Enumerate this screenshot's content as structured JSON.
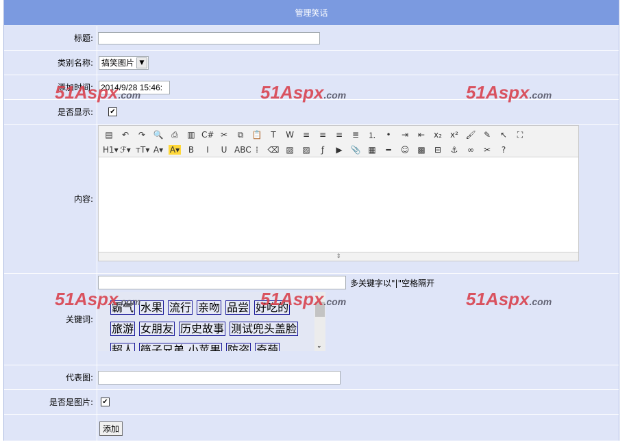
{
  "header": {
    "title": "管理笑话"
  },
  "fields": {
    "title_label": "标题:",
    "category_label": "类别名称:",
    "category_value": "搞笑图片",
    "time_label": "添加时间:",
    "time_value": "2014/9/28 15:46:",
    "show_label": "是否显示:",
    "show_checked": true,
    "content_label": "内容:",
    "keywords_label": "关键词:",
    "keywords_hint": "多关键字以\"|\"空格隔开",
    "image_label": "代表图:",
    "is_image_label": "是否是图片:",
    "is_image_checked": true,
    "submit_label": "添加"
  },
  "toolbar": {
    "row1": [
      "source",
      "undo",
      "redo",
      "preview",
      "print",
      "template",
      "code",
      "cut",
      "copy",
      "paste",
      "paste-text",
      "paste-word",
      "align-left",
      "align-center",
      "align-right",
      "justify",
      "ordered-list",
      "unordered-list",
      "indent",
      "outdent",
      "subscript",
      "superscript",
      "clear-format",
      "select-all",
      "select",
      "fullscreen"
    ],
    "row2": [
      "H1",
      "font",
      "size",
      "forecolor",
      "hilitecolor",
      "B",
      "I",
      "U",
      "ABC",
      "line-height",
      "eraser",
      "image",
      "multi-image",
      "flash",
      "media",
      "attachment",
      "table",
      "hr",
      "emoticon",
      "map",
      "pagebreak",
      "anchor",
      "link",
      "unlink",
      "help"
    ]
  },
  "keywords": [
    [
      "霸气",
      "水果",
      "流行",
      "亲吻",
      "品尝",
      "好吃的"
    ],
    [
      "旅游",
      "女朋友",
      "历史故事",
      "测试兜头盖脸"
    ],
    [
      "超人",
      "筷子兄弟 小苹果",
      "防盗",
      "奇葩"
    ]
  ],
  "watermark": "51Aspx.com"
}
